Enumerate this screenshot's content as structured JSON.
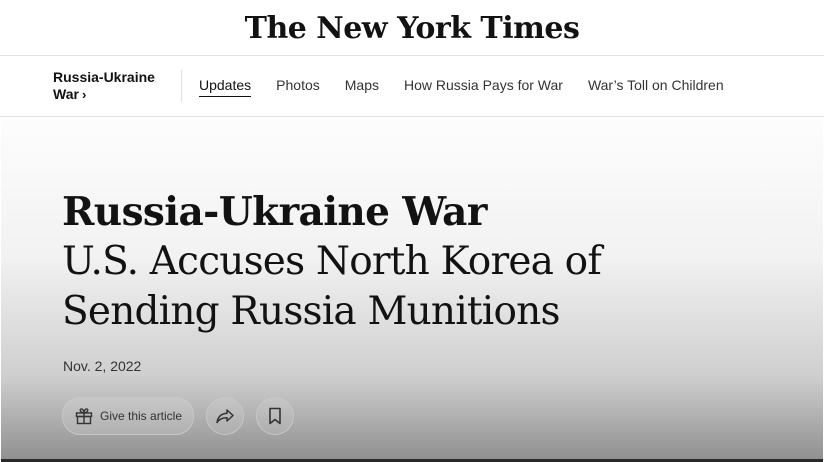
{
  "masthead": {
    "logo_text": "The New York Times"
  },
  "subnav": {
    "section_label": "Russia-Ukraine War",
    "section_chevron": "›",
    "tabs": [
      {
        "label": "Updates",
        "active": true
      },
      {
        "label": "Photos",
        "active": false
      },
      {
        "label": "Maps",
        "active": false
      },
      {
        "label": "How Russia Pays for War",
        "active": false
      },
      {
        "label": "War’s Toll on Children",
        "active": false
      }
    ]
  },
  "article": {
    "kicker": "Russia-Ukraine War",
    "headline": "U.S. Accuses North Korea of Sending Russia Munitions",
    "date": "Nov. 2, 2022",
    "gift_label": "Give this article",
    "icons": {
      "gift": "gift-icon",
      "share": "share-icon",
      "save": "bookmark-icon"
    }
  }
}
